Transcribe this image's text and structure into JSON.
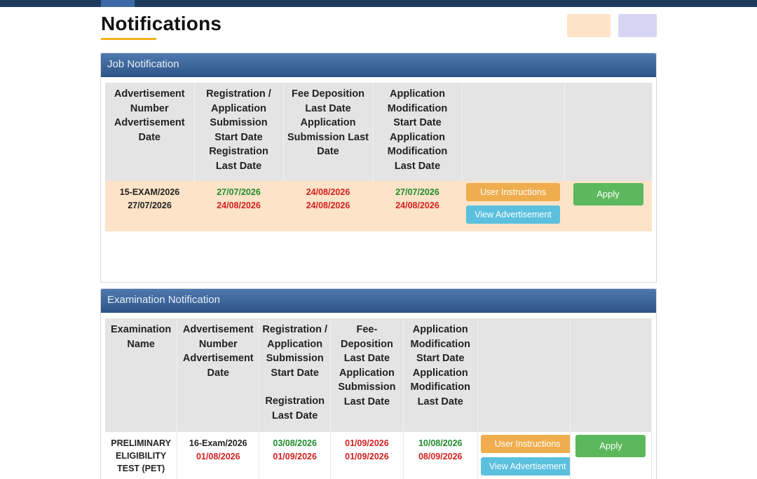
{
  "page": {
    "title": "Notifications"
  },
  "job": {
    "header": "Job Notification",
    "columns": [
      "Advertisement Number Advertisement Date",
      "Registration / Application Submission Start Date Registration Last Date",
      "Fee Deposition Last Date Application Submission Last Date",
      "Application Modification Start Date Application Modification Last Date"
    ],
    "row": {
      "adv_number": "15-EXAM/2026",
      "adv_date": "27/07/2026",
      "reg_start": "27/07/2026",
      "reg_last": "24/08/2026",
      "fee_last": "24/08/2026",
      "sub_last": "24/08/2026",
      "mod_start": "27/07/2026",
      "mod_last": "24/08/2026",
      "user_instructions": "User Instructions",
      "view_advertisement": "View Advertisement",
      "apply": "Apply"
    }
  },
  "exam": {
    "header": "Examination Notification",
    "columns": [
      "Examination Name",
      "Advertisement Number Advertisement Date",
      "Registration / Application Submission Start Date",
      "Registration Last Date",
      "Fee- Deposition Last Date Application Submission Last Date",
      "Application Modification Start Date Application Modification Last Date"
    ],
    "row": {
      "exam_name": "PRELIMINARY ELIGIBILITY TEST (PET)",
      "adv_number": "16-Exam/2026",
      "adv_date": "01/08/2026",
      "reg_start": "03/08/2026",
      "reg_last": "01/09/2026",
      "fee_last": "01/09/2026",
      "sub_last": "01/09/2026",
      "mod_start": "10/08/2026",
      "mod_last": "08/09/2026",
      "user_instructions": "User Instructions",
      "view_advertisement": "View Advertisement",
      "apply": "Apply"
    }
  },
  "colors": {
    "header_blue": "#2d5488",
    "row_peach": "#fde3c8",
    "date_green": "#1e8c2a",
    "date_red": "#d42020",
    "btn_orange": "#f0ad4e",
    "btn_blue": "#5bc0de",
    "btn_green": "#5cb85c",
    "title_underline": "#f2b21c"
  }
}
